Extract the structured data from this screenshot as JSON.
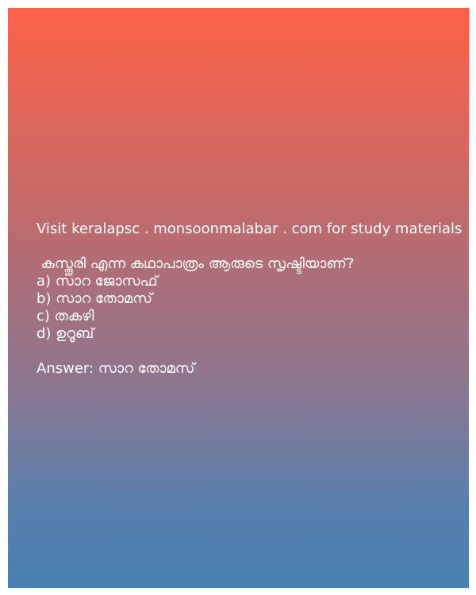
{
  "promo_text": "Visit keralapsc . monsoonmalabar . com for study materials",
  "question": " കസ്തൂരി എന്ന കഥാപാത്രം ആരുടെ സൃഷ്ടിയാണ്?",
  "options": [
    "a) സാറ ജോസഫ്",
    "b) സാറ തോമസ്",
    "c) തകഴി",
    "d) ഉറൂബ്"
  ],
  "answer": "Answer: സാറ തോമസ്",
  "colors": {
    "gradient_top": "#ff6247",
    "gradient_bottom": "#4780b3",
    "text": "#ffffff"
  }
}
